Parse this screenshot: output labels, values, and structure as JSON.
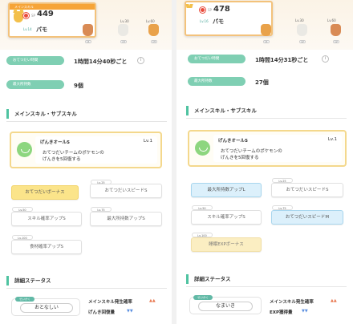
{
  "left": {
    "card": {
      "header": "メインスキル",
      "sp_label": "SP",
      "sp": "449",
      "level": "Lv.14",
      "name": "パモ"
    },
    "ingredients": [
      {
        "level": "Lv.30",
        "count": "x1",
        "color": "#d98b55"
      },
      {
        "level": "Lv.60",
        "count": "x3",
        "color": "#eae9e4"
      },
      {
        "level": "",
        "count": "x3",
        "color": "#e9a24a"
      }
    ],
    "stats": [
      {
        "label": "おてつだい時間",
        "value": "1時間14分40秒ごと",
        "info": "i"
      },
      {
        "label": "最大所持数",
        "value": "9個"
      }
    ],
    "section_skill": "メインスキル・サブスキル",
    "skill": {
      "name": "げんきオールS",
      "level": "Lv.1",
      "desc1": "おてつだいチームのポケモンの",
      "desc2": "げんきを5回復する"
    },
    "subskills": [
      {
        "label": "おてつだいボーナス",
        "tag": "",
        "style": "gold"
      },
      {
        "label": "おてつだいスピードS",
        "tag": "Lv.25",
        "style": ""
      },
      {
        "label": "スキル確率アップS",
        "tag": "Lv.50",
        "style": ""
      },
      {
        "label": "最大所持数アップS",
        "tag": "Lv.75",
        "style": ""
      },
      {
        "label": "食材確率アップS",
        "tag": "Lv.100",
        "style": ""
      }
    ],
    "section_detail": "詳細ステータス",
    "nature": {
      "tag": "せいかく",
      "name": "おとなしい",
      "up": "メインスキル発生確率",
      "down": "げんき回復量",
      "up_arrows": "▲▲",
      "down_arrows": "▼▼"
    }
  },
  "right": {
    "card": {
      "sp_label": "SP",
      "sp": "478",
      "level": "Lv.16",
      "name": "パモ"
    },
    "ingredients": [
      {
        "level": "Lv.30",
        "count": "x1",
        "color": "#e9a24a"
      },
      {
        "level": "Lv.60",
        "count": "x2",
        "color": "#eae9e4"
      },
      {
        "level": "",
        "count": "x2",
        "color": "#d98b55"
      }
    ],
    "stats": [
      {
        "label": "おてつだい時間",
        "value": "1時間14分31秒ごと",
        "info": "i"
      },
      {
        "label": "最大所持数",
        "value": "27個"
      }
    ],
    "section_skill": "メインスキル・サブスキル",
    "skill": {
      "name": "げんきオールS",
      "level": "Lv.1",
      "desc1": "おてつだいチームのポケモンの",
      "desc2": "げんきを5回復する"
    },
    "subskills": [
      {
        "label": "最大所持数アップL",
        "tag": "",
        "style": "blue"
      },
      {
        "label": "おてつだいスピードS",
        "tag": "Lv.25",
        "style": ""
      },
      {
        "label": "スキル確率アップS",
        "tag": "Lv.50",
        "style": ""
      },
      {
        "label": "おてつだいスピードM",
        "tag": "Lv.75",
        "style": "blue"
      },
      {
        "label": "睡眠EXPボーナス",
        "tag": "Lv.100",
        "style": "pale"
      }
    ],
    "section_detail": "詳細ステータス",
    "nature": {
      "tag": "せいかく",
      "name": "なまいき",
      "up": "メインスキル発生確率",
      "down": "EXP獲得量",
      "up_arrows": "▲▲",
      "down_arrows": "▼▼"
    }
  }
}
